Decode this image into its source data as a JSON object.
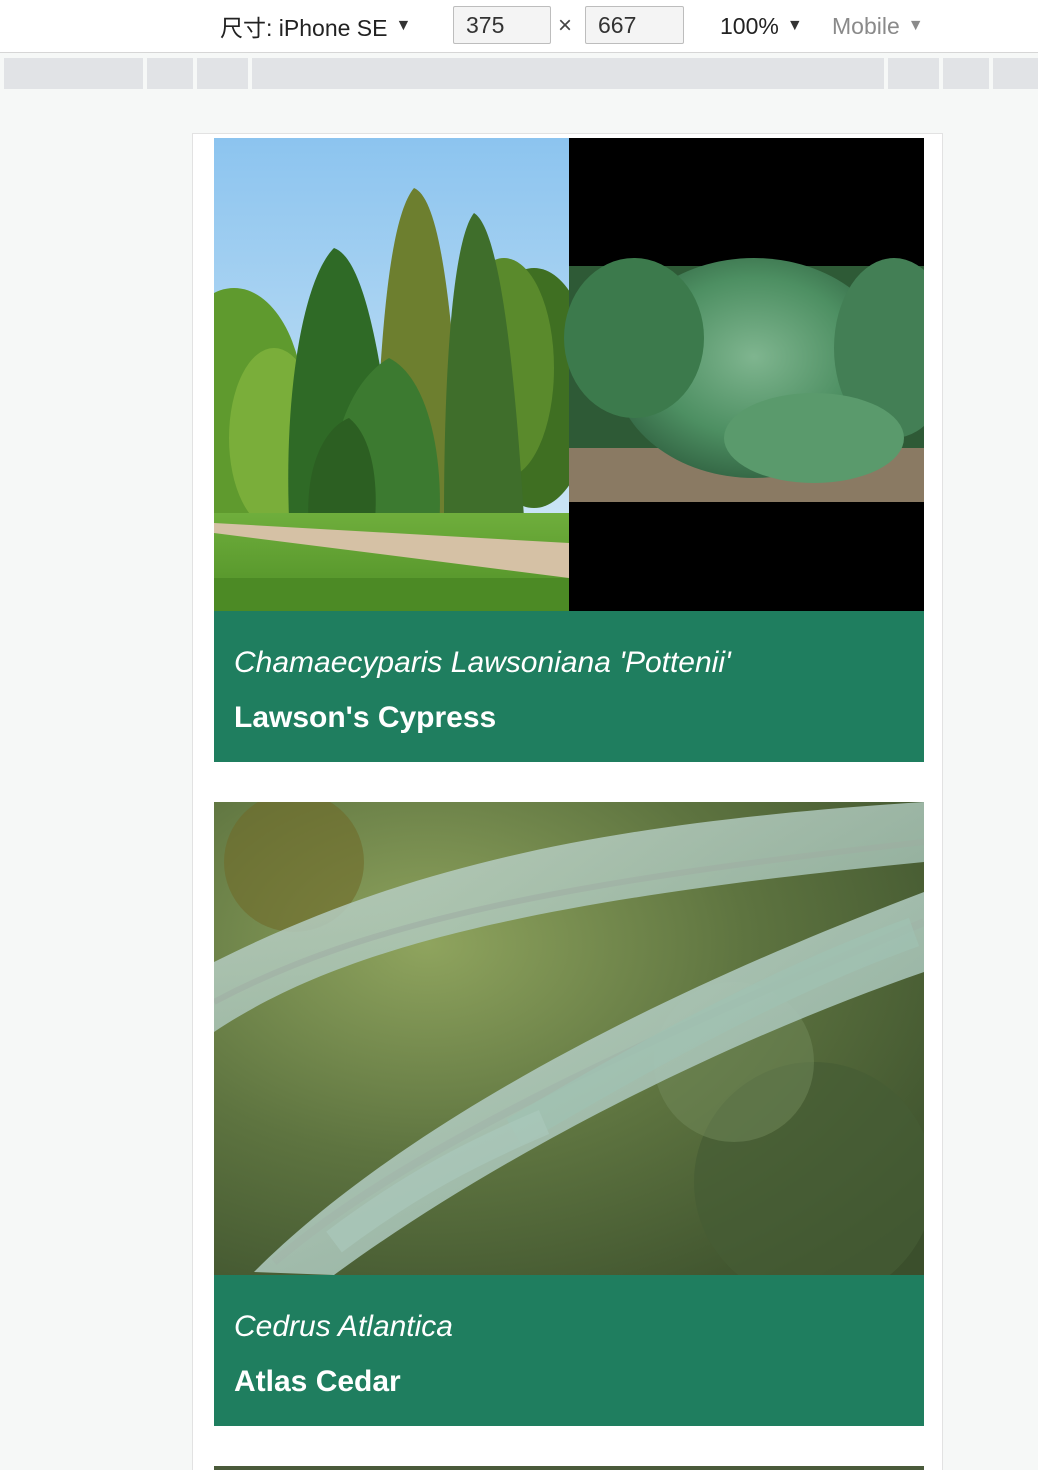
{
  "devtools": {
    "device_label": "尺寸: iPhone SE",
    "width_value": "375",
    "height_value": "667",
    "times_symbol": "×",
    "zoom_label": "100%",
    "mode_label": "Mobile",
    "caret": "▼"
  },
  "cards": [
    {
      "latin_name": "Chamaecyparis Lawsoniana 'Pottenii'",
      "common_name": "Lawson's Cypress"
    },
    {
      "latin_name": "Cedrus Atlantica",
      "common_name": "Atlas Cedar"
    }
  ],
  "colors": {
    "caption_bg": "#1f7e5f",
    "page_bg": "#f6f8f7"
  }
}
